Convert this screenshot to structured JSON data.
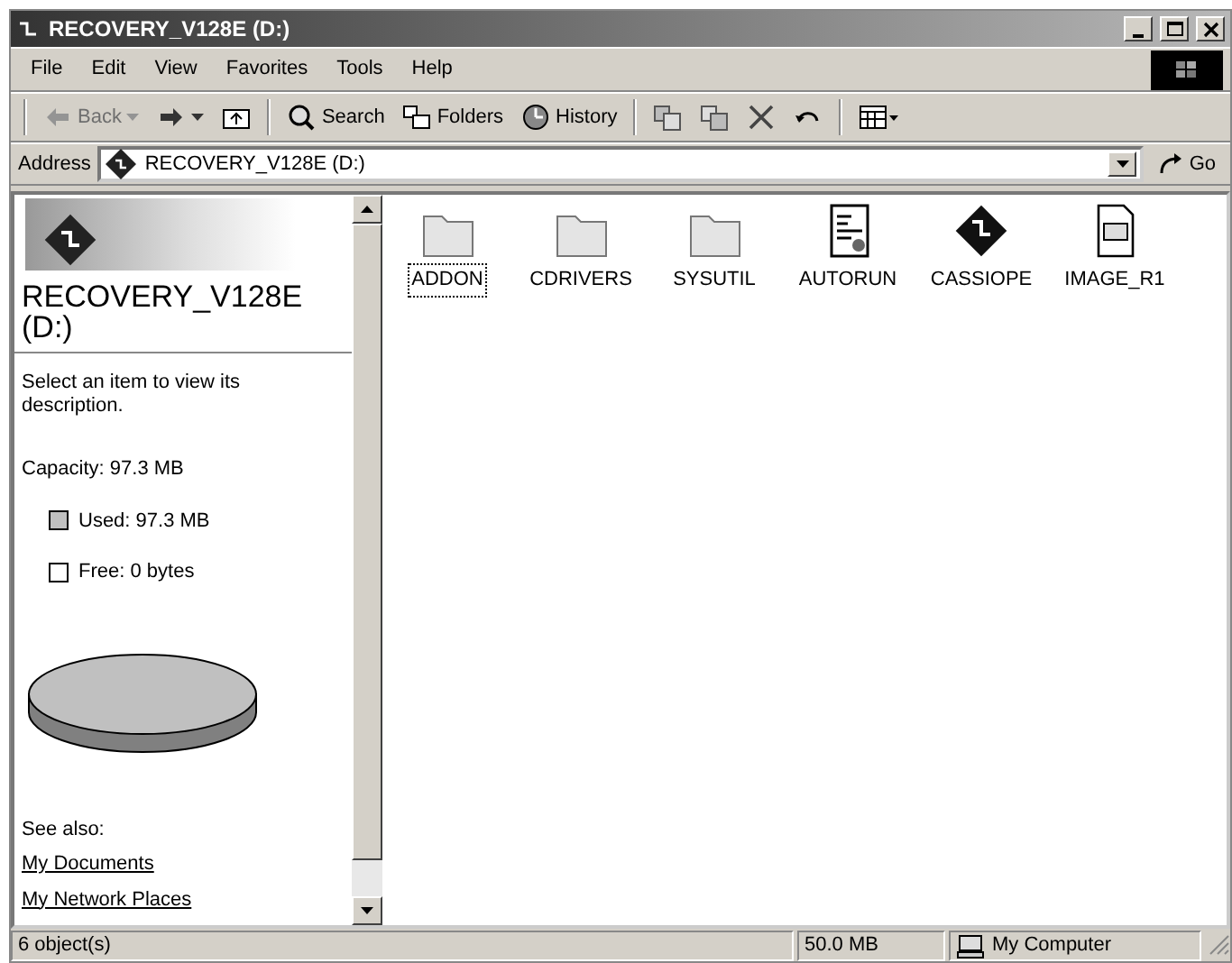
{
  "window": {
    "title": "RECOVERY_V128E (D:)"
  },
  "menu": [
    "File",
    "Edit",
    "View",
    "Favorites",
    "Tools",
    "Help"
  ],
  "toolbar": [
    {
      "kind": "back",
      "label": "Back",
      "disabled": true
    },
    {
      "kind": "forward",
      "disabled": false
    },
    {
      "kind": "up",
      "disabled": false
    },
    {
      "kind": "sep"
    },
    {
      "kind": "search",
      "label": "Search",
      "disabled": false
    },
    {
      "kind": "folders",
      "label": "Folders",
      "disabled": false
    },
    {
      "kind": "history",
      "label": "History",
      "disabled": false
    },
    {
      "kind": "sep"
    },
    {
      "kind": "moveto",
      "disabled": false
    },
    {
      "kind": "copyto",
      "disabled": false
    },
    {
      "kind": "delete",
      "disabled": false
    },
    {
      "kind": "undo",
      "disabled": false
    },
    {
      "kind": "sep"
    },
    {
      "kind": "views",
      "disabled": false
    }
  ],
  "address": {
    "label": "Address",
    "value": "RECOVERY_V128E (D:)",
    "go": "Go"
  },
  "side_panel": {
    "title": "RECOVERY_V128E (D:)",
    "hint": "Select an item to view its description.",
    "capacity": "Capacity: 97.3 MB",
    "legend": [
      {
        "label": "Used: 97.3 MB",
        "color": "#c0c0c0"
      },
      {
        "label": "Free: 0 bytes",
        "color": "#ffffff"
      }
    ],
    "see_also": "See also:",
    "links": [
      "My Documents",
      "My Network Places"
    ]
  },
  "files": [
    {
      "name": "ADDON",
      "kind": "folder",
      "selected": true
    },
    {
      "name": "CDRIVERS",
      "kind": "folder",
      "selected": false
    },
    {
      "name": "SYSUTIL",
      "kind": "folder",
      "selected": false
    },
    {
      "name": "AUTORUN",
      "kind": "settings",
      "selected": false
    },
    {
      "name": "CASSIOPE",
      "kind": "app",
      "selected": false
    },
    {
      "name": "IMAGE_R1",
      "kind": "web",
      "selected": false
    }
  ],
  "status_bar": {
    "objects": "6 object(s)",
    "size": "50.0 MB",
    "zone": "My Computer"
  }
}
